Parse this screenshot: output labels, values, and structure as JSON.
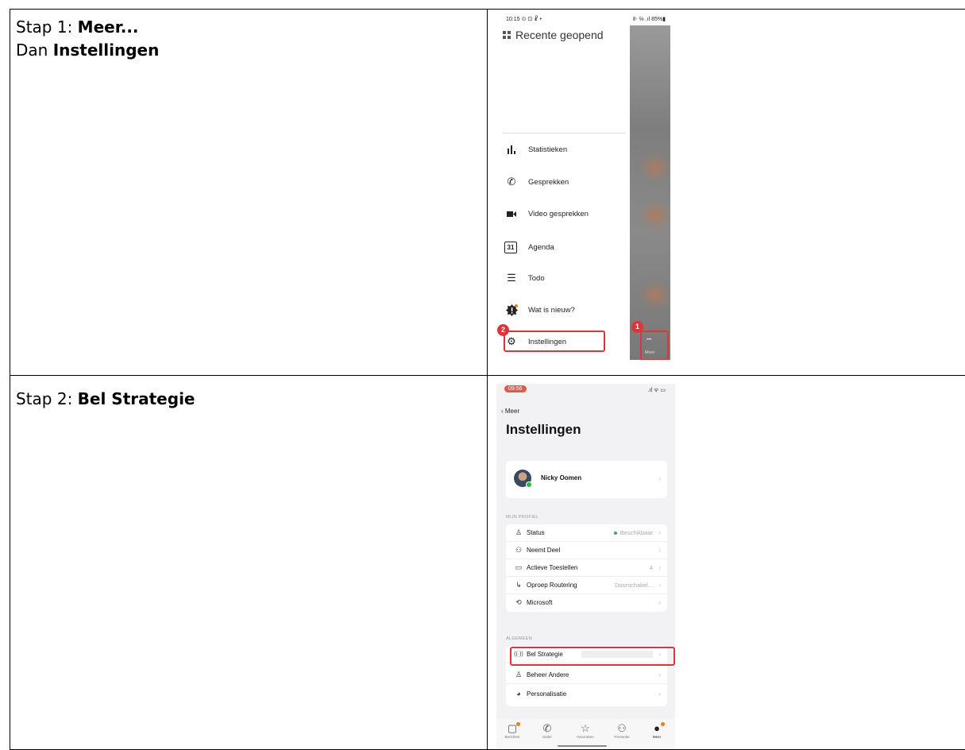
{
  "steps": [
    {
      "line1_prefix": "Stap 1: ",
      "line1_bold": "Meer...",
      "line2_prefix": "Dan ",
      "line2_bold": "Instellingen"
    },
    {
      "line1_prefix": "Stap 2: ",
      "line1_bold": "Bel Strategie"
    }
  ],
  "phone1": {
    "status_left": "10:15 ⊙ ⊡ ☧ •",
    "status_right": "⊪ ℅ .ıl 85%▮",
    "header": "Recente geopend",
    "menu": [
      {
        "label": "Statistieken",
        "icon": "bar-chart-icon"
      },
      {
        "label": "Gesprekken",
        "icon": "phone-icon"
      },
      {
        "label": "Video gesprekken",
        "icon": "video-icon"
      },
      {
        "label": "Agenda",
        "icon": "calendar-icon",
        "glyph": "31"
      },
      {
        "label": "Todo",
        "icon": "list-icon"
      },
      {
        "label": "Wat is nieuw?",
        "icon": "news-icon"
      },
      {
        "label": "Instellingen",
        "icon": "gear-icon"
      }
    ],
    "badge_1": "1",
    "badge_2": "2",
    "meer_label": "Meer",
    "meer_dots": "•••"
  },
  "phone2": {
    "time": "09:56",
    "status_right": ".ıl ᯤ ▭",
    "back_label": "Meer",
    "title": "Instellingen",
    "profile_name": "Nicky Oomen",
    "section_profile": "MIJN PROFIEL",
    "profile_rows": [
      {
        "label": "Status",
        "value": "Beschikbaar",
        "icon": "person-icon"
      },
      {
        "label": "Neemt Deel",
        "value": "",
        "icon": "people-icon"
      },
      {
        "label": "Actieve Toestellen",
        "value": "4",
        "icon": "devices-icon"
      },
      {
        "label": "Oproep Routering",
        "value": "Doorschakel...",
        "icon": "routing-icon"
      },
      {
        "label": "Microsoft",
        "value": "",
        "icon": "sync-icon"
      }
    ],
    "section_general": "ALGEMEEN",
    "general_rows": [
      {
        "label": "Bel Strategie",
        "icon": "antenna-icon"
      },
      {
        "label": "Beheer Andere",
        "icon": "manage-icon"
      },
      {
        "label": "Personalisatie",
        "icon": "palette-icon"
      }
    ],
    "tabs": [
      {
        "label": "Berichten",
        "icon": "chat-icon"
      },
      {
        "label": "Dialer",
        "icon": "phone-icon"
      },
      {
        "label": "Favorieten",
        "icon": "star-icon"
      },
      {
        "label": "Presentie",
        "icon": "people-icon"
      },
      {
        "label": "Meer",
        "icon": "more-icon"
      }
    ]
  }
}
